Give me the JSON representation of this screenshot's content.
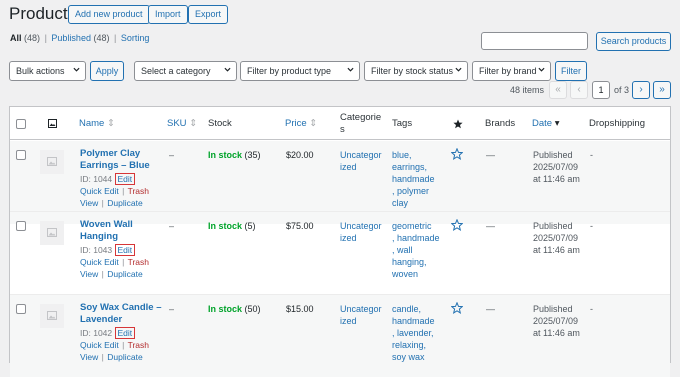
{
  "header": {
    "title": "Products",
    "buttons": [
      "Add new product",
      "Import",
      "Export"
    ]
  },
  "views": {
    "all": "All",
    "all_count": "(48)",
    "published": "Published",
    "published_count": "(48)",
    "sorting": "Sorting",
    "sep": "|"
  },
  "search": {
    "value": "",
    "button": "Search products"
  },
  "filters": {
    "bulk_actions": "Bulk actions",
    "apply": "Apply",
    "category": "Select a category",
    "product_type": "Filter by product type",
    "stock_status": "Filter by stock status",
    "brand": "Filter by brand",
    "filter": "Filter"
  },
  "pagination": {
    "items": "48 items",
    "first": "«",
    "prev": "‹",
    "current_page": "1",
    "of": "of 3",
    "next": "›",
    "last": "»"
  },
  "columns": {
    "name": "Name",
    "sku": "SKU",
    "stock": "Stock",
    "price": "Price",
    "categories_line1": "Categorie",
    "categories_line2": "s",
    "tags": "Tags",
    "brands": "Brands",
    "date": "Date",
    "dropshipping": "Dropshipping"
  },
  "row_actions": {
    "edit": "Edit",
    "quick_edit": "Quick Edit",
    "trash": "Trash",
    "view": "View",
    "duplicate": "Duplicate",
    "pipe": "|"
  },
  "products": [
    {
      "name_lines": [
        "Polymer Clay",
        "Earrings – Blue"
      ],
      "id": "ID: 1044",
      "sku": "–",
      "stock_label": "In stock",
      "stock_count": "(35)",
      "price": "$20.00",
      "category_lines": [
        "Uncategor",
        "ized"
      ],
      "tag_lines": [
        "blue,",
        "earrings,",
        "handmade",
        ", polymer",
        "clay"
      ],
      "brands": "—",
      "date_lines": [
        "Published",
        "2025/07/09",
        "at 11:46 am"
      ],
      "dropshipping": "-"
    },
    {
      "name_lines": [
        "Woven Wall",
        "Hanging"
      ],
      "id": "ID: 1043",
      "sku": "–",
      "stock_label": "In stock",
      "stock_count": "(5)",
      "price": "$75.00",
      "category_lines": [
        "Uncategor",
        "ized"
      ],
      "tag_lines": [
        "geometric",
        ", handmade",
        ", wall",
        "hanging,",
        "woven"
      ],
      "brands": "—",
      "date_lines": [
        "Published",
        "2025/07/09",
        "at 11:46 am"
      ],
      "dropshipping": "-"
    },
    {
      "name_lines": [
        "Soy Wax Candle –",
        "Lavender"
      ],
      "id": "ID: 1042",
      "sku": "–",
      "stock_label": "In stock",
      "stock_count": "(50)",
      "price": "$15.00",
      "category_lines": [
        "Uncategor",
        "ized"
      ],
      "tag_lines": [
        "candle,",
        "handmade",
        ", lavender,",
        "relaxing,",
        "soy wax"
      ],
      "brands": "—",
      "date_lines": [
        "Published",
        "2025/07/09",
        "at 11:46 am"
      ],
      "dropshipping": "-"
    }
  ]
}
